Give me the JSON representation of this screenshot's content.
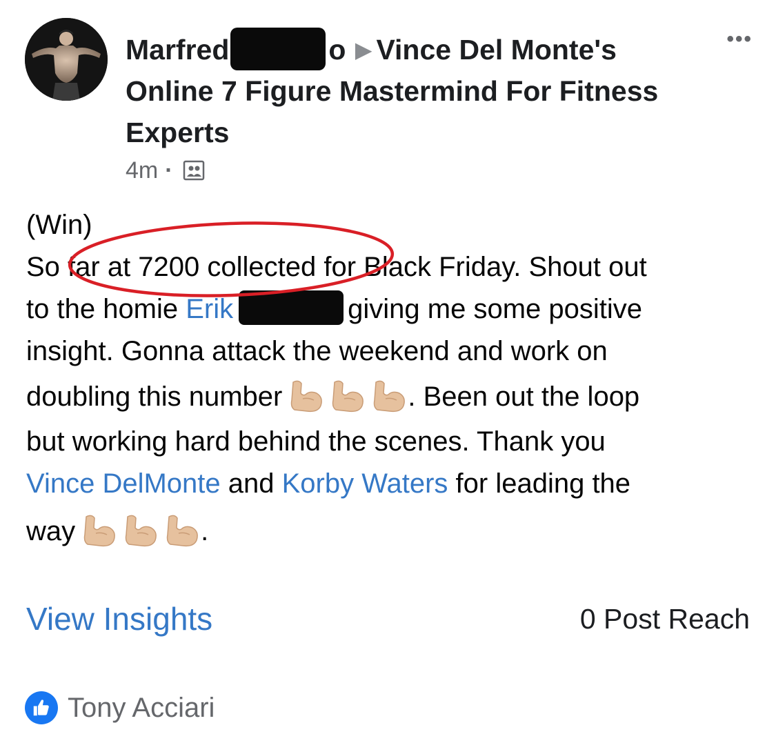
{
  "post": {
    "author": "Marfred",
    "author_suffix": "o",
    "group_name": "Vince Del Monte's Online 7 Figure Mastermind For Fitness Experts",
    "time": "4m",
    "separator": "·",
    "more_icon": "more-horizontal-icon",
    "privacy_icon": "group-icon"
  },
  "body": {
    "line1": "(Win)",
    "line2": "So far at 7200 collected for Black Friday. Shout out",
    "line3_pre": "to the homie ",
    "line3_mention": "Erik",
    "line3_post": "giving me some positive",
    "line4": "insight. Gonna attack the weekend and work on",
    "line5_pre": "doubling this number",
    "line5_post": ". Been out the loop",
    "line6": "but working hard behind the scenes. Thank you",
    "line7_mention1": "Vince DelMonte",
    "line7_mid": " and ",
    "line7_mention2": "Korby Waters",
    "line7_post": " for leading the",
    "line8_pre": "way",
    "line8_post": ".",
    "emoji": "flexed-biceps-icon",
    "annotation_color": "#d91f26"
  },
  "footer": {
    "insights_label": "View Insights",
    "reach_label": "0 Post Reach"
  },
  "reactions": {
    "icon": "thumbs-up-icon",
    "liker_name": "Tony Acciari"
  },
  "colors": {
    "link": "#3578c6",
    "muted": "#65676b",
    "like_blue": "#1877f2"
  }
}
